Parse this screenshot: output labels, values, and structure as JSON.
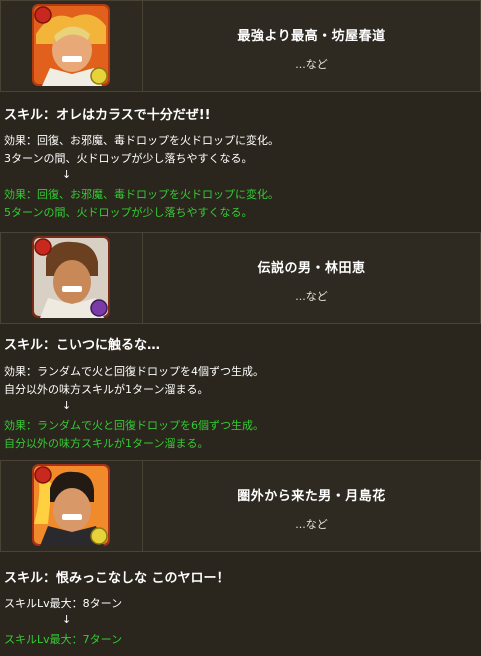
{
  "entries": [
    {
      "name": "最強より最高・坊屋春道",
      "sub": "...など",
      "skill_title": "スキル：オレはカラスで十分だぜ!!",
      "before": [
        "効果：回復、お邪魔、毒ドロップを火ドロップに変化。",
        "3ターンの間、火ドロップが少し落ちやすくなる。"
      ],
      "arrow": "↓",
      "after": [
        "効果：回復、お邪魔、毒ドロップを火ドロップに変化。",
        "5ターンの間、火ドロップが少し落ちやすくなる。"
      ]
    },
    {
      "name": "伝説の男・林田恵",
      "sub": "...など",
      "skill_title": "スキル：こいつに触るな…",
      "before": [
        "効果：ランダムで火と回復ドロップを4個ずつ生成。",
        "自分以外の味方スキルが1ターン溜まる。"
      ],
      "arrow": "↓",
      "after": [
        "効果：ランダムで火と回復ドロップを6個ずつ生成。",
        "自分以外の味方スキルが1ターン溜まる。"
      ]
    },
    {
      "name": "圏外から来た男・月島花",
      "sub": "...など",
      "skill_title": "スキル：恨みっこなしな このヤロー！",
      "before": [
        "スキルLv最大：8ターン"
      ],
      "arrow": "↓",
      "after": [
        "スキルLv最大：7ターン"
      ]
    }
  ],
  "colors": {
    "background": "#2b261d",
    "card": "#2f2a21",
    "border": "#4a4234",
    "upgrade_text": "#33cc33"
  },
  "icons": [
    "fire-orb-icon",
    "light-orb-icon",
    "dark-orb-icon"
  ]
}
